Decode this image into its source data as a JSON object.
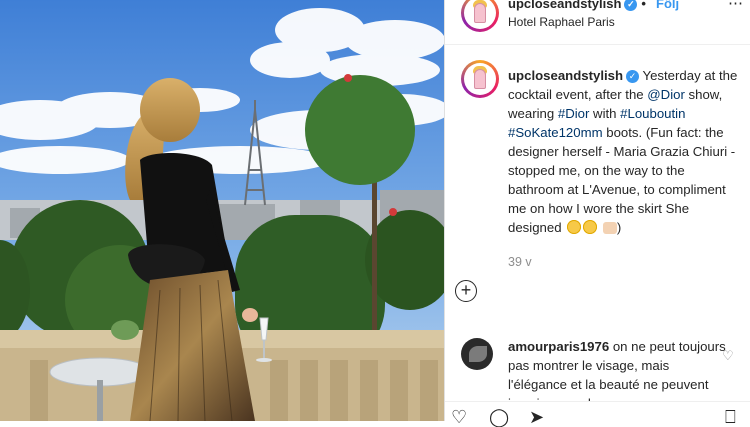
{
  "post": {
    "username": "upcloseandstylish",
    "verified_glyph": "✓",
    "separator": "•",
    "follow_label": "Följ",
    "more_label": "⋯",
    "location": "Hotel Raphael Paris"
  },
  "caption": {
    "username": "upcloseandstylish",
    "text_1": "Yesterday at the cocktail event, after the ",
    "mention": "@Dior",
    "text_2": " show, wearing ",
    "tag_1": "#Dior",
    "text_3": " with ",
    "tag_2": "#Louboutin",
    "text_4": " ",
    "tag_3": "#SoKate120mm",
    "text_5": " boots. (Fun fact: the designer herself - Maria Grazia Chiuri - stopped me, on the way to the bathroom at L'Avenue, to compliment me on how I wore the skirt She designed ",
    "time": "39 v"
  },
  "add_comment_label": "+",
  "comment": {
    "username": "amourparis1976",
    "text": " on ne peut toujours pas montrer le visage, mais l'élégance et la beauté ne peuvent jamais se cacher",
    "like_glyph": "♡"
  },
  "icons": {
    "avatar": "avatar-icon",
    "verified": "verified-badge-icon",
    "add": "add-comment-icon",
    "like": "heart-icon",
    "comment": "comment-icon",
    "share": "share-icon",
    "bookmark": "bookmark-icon"
  },
  "actions": {
    "like_glyph": "♡",
    "comment_glyph": "◯",
    "share_glyph": "➤",
    "bookmark_glyph": "⎕"
  },
  "colors": {
    "link": "#003569",
    "follow": "#3897f0",
    "verified": "#3897f0",
    "muted": "#8e8e8e",
    "text": "#262626"
  }
}
